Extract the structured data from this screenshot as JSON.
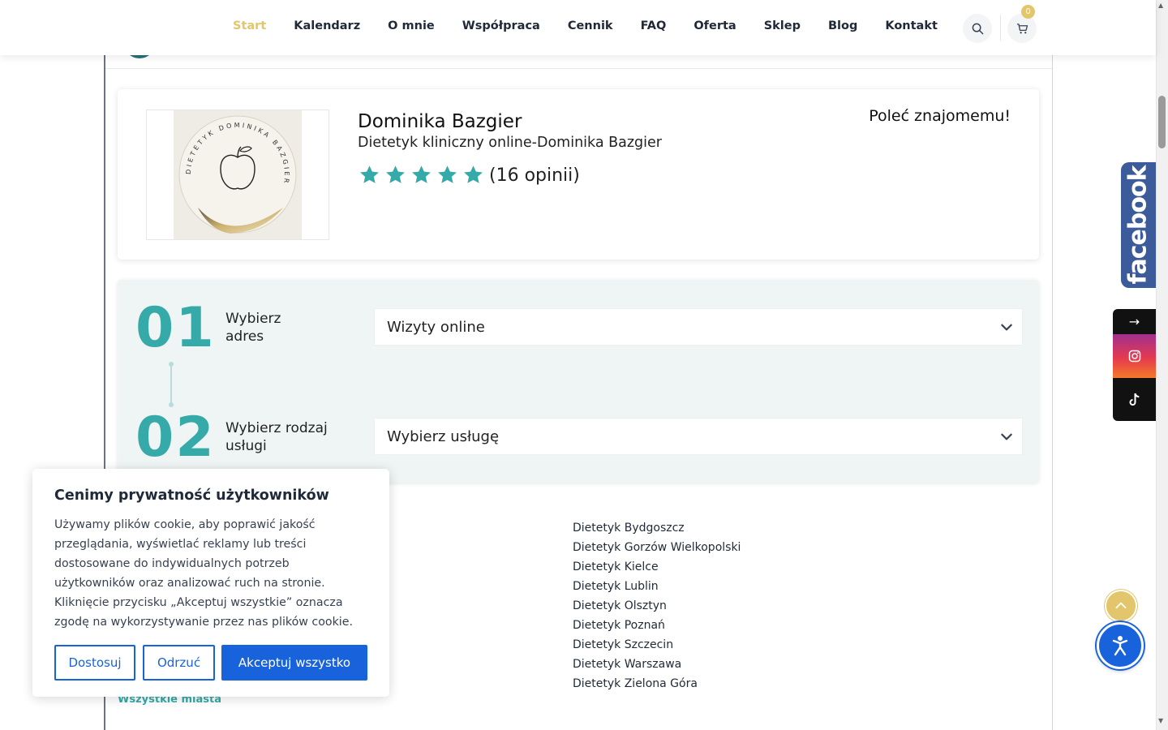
{
  "nav": {
    "items": [
      "Start",
      "Kalendarz",
      "O mnie",
      "Współpraca",
      "Cennik",
      "FAQ",
      "Oferta",
      "Sklep",
      "Blog",
      "Kontakt"
    ],
    "active_index": 0,
    "cart_count": "0"
  },
  "profile": {
    "name": "Dominika Bazgier",
    "subtitle": "Dietetyk kliniczny online-Dominika Bazgier",
    "rating_stars": 5,
    "reviews": "(16 opinii)",
    "recommend": "Poleć znajomemu!",
    "logo_text": "DIETETYK DOMINIKA BAZGIER"
  },
  "booking": {
    "steps": [
      {
        "num": "01",
        "label_line1": "Wybierz",
        "label_line2": "adres",
        "select_value": "Wizyty online"
      },
      {
        "num": "02",
        "label_line1": "Wybierz rodzaj",
        "label_line2": "usługi",
        "select_value": "Wybierz usługę"
      }
    ]
  },
  "cities": [
    "Dietetyk Bydgoszcz",
    "Dietetyk Gorzów Wielkopolski",
    "Dietetyk Kielce",
    "Dietetyk Lublin",
    "Dietetyk Olsztyn",
    "Dietetyk Poznań",
    "Dietetyk Szczecin",
    "Dietetyk Warszawa",
    "Dietetyk Zielona Góra"
  ],
  "all_cities_link": "Wszystkie miasta",
  "cookie": {
    "title": "Cenimy prywatność użytkowników",
    "body": "Używamy plików cookie, aby poprawić jakość przeglądania, wyświetlać reklamy lub treści dostosowane do indywidualnych potrzeb użytkowników oraz analizować ruch na stronie. Kliknięcie przycisku „Akceptuj wszystkie” oznacza zgodę na wykorzystywanie przez nas plików cookie.",
    "btn_customize": "Dostosuj",
    "btn_reject": "Odrzuć",
    "btn_accept": "Akceptuj wszystko"
  },
  "social": {
    "facebook_label": "facebook",
    "arrow": "→"
  },
  "colors": {
    "accent_gold": "#e3c56b",
    "teal": "#35aaa8",
    "primary_blue": "#1863dc",
    "facebook_blue": "#3b5b9a"
  }
}
